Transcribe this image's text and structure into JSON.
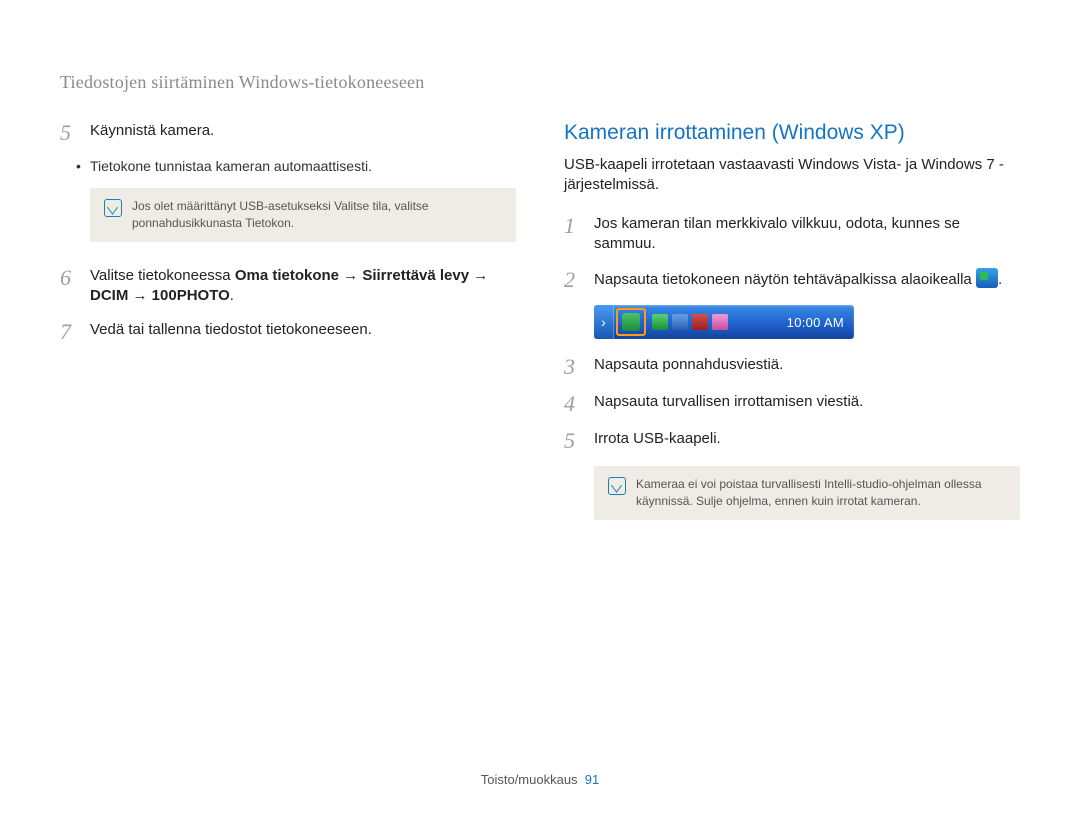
{
  "header": {
    "title": "Tiedostojen siirtäminen Windows-tietokoneeseen"
  },
  "left": {
    "step5": {
      "num": "5",
      "text": "Käynnistä kamera."
    },
    "step5_bullet": "Tietokone tunnistaa kameran automaattisesti.",
    "note1_a": "Jos olet määrittänyt USB-asetukseksi ",
    "note1_b_bold": "Valitse tila",
    "note1_c": ", valitse ponnahdusikkunasta ",
    "note1_d_bold": "Tietokon",
    "note1_e": ".",
    "step6": {
      "num": "6",
      "a": "Valitse tietokoneessa ",
      "b_bold": "Oma tietokone",
      "arrow1": " → ",
      "c_bold": "Siirrettävä levy",
      "arrow2": " → ",
      "d_bold": "DCIM",
      "arrow3": " → ",
      "e_bold": "100PHOTO",
      "f": "."
    },
    "step7": {
      "num": "7",
      "text": "Vedä tai tallenna tiedostot tietokoneeseen."
    }
  },
  "right": {
    "heading": "Kameran irrottaminen (Windows XP)",
    "intro": "USB-kaapeli irrotetaan vastaavasti Windows Vista- ja Windows 7 -järjestelmissä.",
    "step1": {
      "num": "1",
      "text": "Jos kameran tilan merkkivalo vilkkuu, odota, kunnes se sammuu."
    },
    "step2": {
      "num": "2",
      "text": "Napsauta tietokoneen näytön tehtäväpalkissa alaoikealla "
    },
    "taskbar_clock": "10:00 AM",
    "step3": {
      "num": "3",
      "text": "Napsauta ponnahdusviestiä."
    },
    "step4": {
      "num": "4",
      "text": "Napsauta turvallisen irrottamisen viestiä."
    },
    "step5": {
      "num": "5",
      "text": "Irrota USB-kaapeli."
    },
    "note2": "Kameraa ei voi poistaa turvallisesti Intelli-studio-ohjelman ollessa käynnissä. Sulje ohjelma, ennen kuin irrotat kameran."
  },
  "footer": {
    "section": "Toisto/muokkaus",
    "page": "91"
  }
}
